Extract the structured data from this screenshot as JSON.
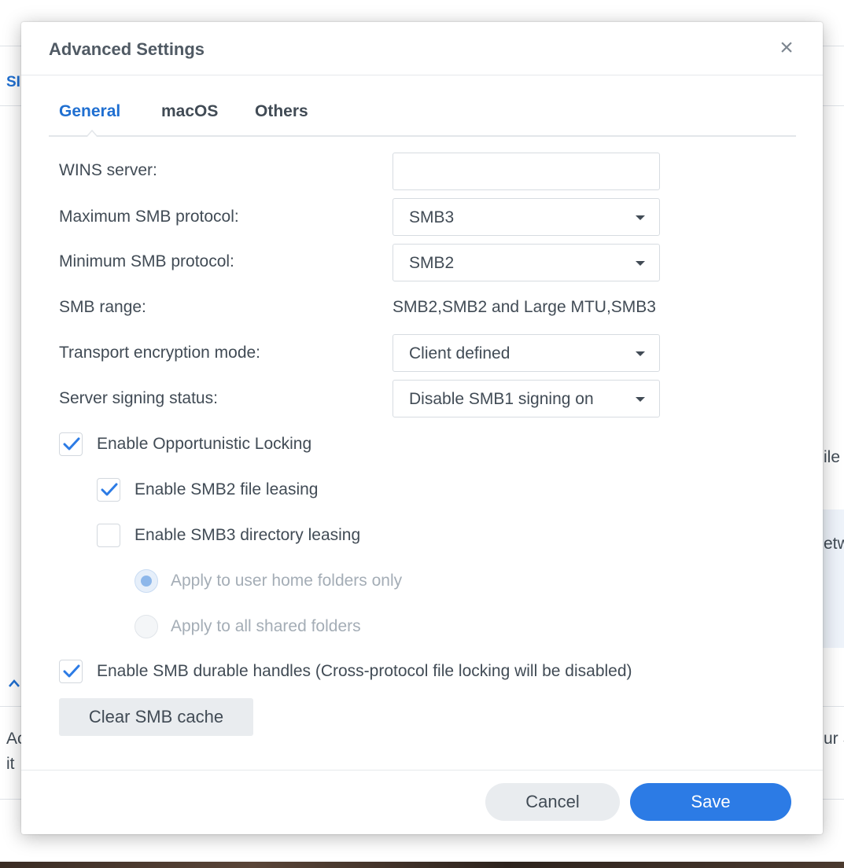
{
  "background": {
    "tab_fragment": "SI",
    "text_right_1": "ile",
    "text_right_2": "etw",
    "text_left_1": "Ac",
    "text_left_2": "it",
    "text_right_3": "ur S"
  },
  "dialog": {
    "title": "Advanced Settings",
    "close_glyph": "×",
    "tabs": [
      {
        "label": "General",
        "active": true
      },
      {
        "label": "macOS",
        "active": false
      },
      {
        "label": "Others",
        "active": false
      }
    ],
    "fields": {
      "wins_server": {
        "label": "WINS server:",
        "value": ""
      },
      "max_smb": {
        "label": "Maximum SMB protocol:",
        "value": "SMB3"
      },
      "min_smb": {
        "label": "Minimum SMB protocol:",
        "value": "SMB2"
      },
      "smb_range": {
        "label": "SMB range:",
        "value": "SMB2,SMB2 and Large MTU,SMB3"
      },
      "transport_encryption": {
        "label": "Transport encryption mode:",
        "value": "Client defined"
      },
      "server_signing": {
        "label": "Server signing status:",
        "value": "Disable SMB1 signing on"
      }
    },
    "options": {
      "oplock": {
        "label": "Enable Opportunistic Locking",
        "checked": true
      },
      "smb2_leasing": {
        "label": "Enable SMB2 file leasing",
        "checked": true
      },
      "smb3_dir_leasing": {
        "label": "Enable SMB3 directory leasing",
        "checked": false
      },
      "apply_home": {
        "label": "Apply to user home folders only",
        "selected": true,
        "disabled": true
      },
      "apply_all": {
        "label": "Apply to all shared folders",
        "selected": false,
        "disabled": true
      },
      "durable_handles": {
        "label": "Enable SMB durable handles (Cross-protocol file locking will be disabled)",
        "checked": true
      }
    },
    "clear_cache_label": "Clear SMB cache",
    "footer": {
      "cancel_label": "Cancel",
      "save_label": "Save"
    }
  },
  "colors": {
    "accent": "#2c7be5",
    "tab_active": "#1f6fd1",
    "text": "#414b55",
    "disabled_text": "#a4adb6"
  }
}
